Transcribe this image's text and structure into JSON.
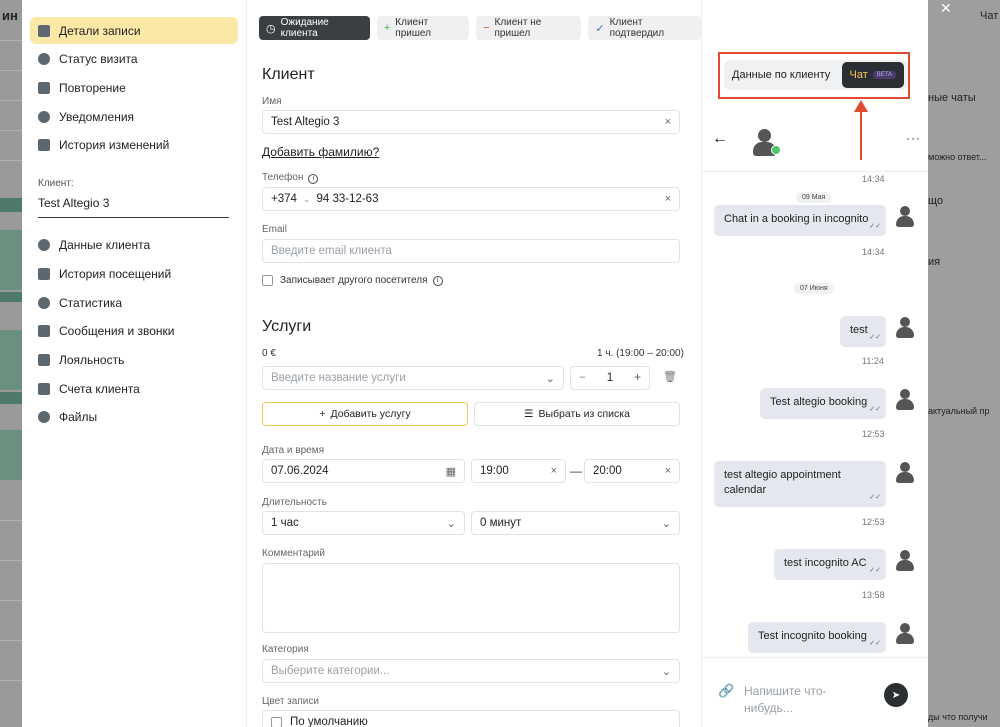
{
  "background": {
    "left_fragment": "ин",
    "right_fragments": [
      "Чат",
      "ные чаты",
      "можно ответ...",
      "що",
      "ия",
      "актуальный пр",
      "ды что получи"
    ],
    "close_symbol": "✕"
  },
  "sidebar": {
    "items": [
      {
        "label": "Детали записи",
        "icon": "calendar-icon"
      },
      {
        "label": "Статус визита",
        "icon": "clock-icon"
      },
      {
        "label": "Повторение",
        "icon": "repeat-icon"
      },
      {
        "label": "Уведомления",
        "icon": "chat-bubbles-icon"
      },
      {
        "label": "История изменений",
        "icon": "document-icon"
      }
    ],
    "client_label": "Клиент:",
    "client_name": "Test Altegio 3",
    "client_items": [
      {
        "label": "Данные клиента",
        "icon": "user-icon"
      },
      {
        "label": "История посещений",
        "icon": "list-icon"
      },
      {
        "label": "Статистика",
        "icon": "pie-chart-icon"
      },
      {
        "label": "Сообщения и звонки",
        "icon": "envelope-icon"
      },
      {
        "label": "Лояльность",
        "icon": "card-icon"
      },
      {
        "label": "Счета клиента",
        "icon": "briefcase-icon"
      },
      {
        "label": "Файлы",
        "icon": "paperclip-icon"
      }
    ]
  },
  "status_buttons": [
    {
      "label": "Ожидание клиента",
      "symbol": "◷"
    },
    {
      "label": "Клиент пришел",
      "symbol": "+"
    },
    {
      "label": "Клиент не пришел",
      "symbol": "−"
    },
    {
      "label": "Клиент подтвердил",
      "symbol": "✓"
    }
  ],
  "client": {
    "title": "Клиент",
    "name_label": "Имя",
    "name_value": "Test Altegio 3",
    "add_surname": "Добавить фамилию?",
    "phone_label": "Телефон",
    "phone_code": "+374",
    "phone_value": "94 33-12-63",
    "email_label": "Email",
    "email_placeholder": "Введите email клиента",
    "other_visitor": "Записывает другого посетителя"
  },
  "services": {
    "title": "Услуги",
    "price": "0 €",
    "duration_summary": "1 ч. (19:00 – 20:00)",
    "service_placeholder": "Введите название услуги",
    "quantity": "1",
    "add_service": "Добавить услугу",
    "choose_from_list": "Выбрать из списка"
  },
  "datetime": {
    "label": "Дата и время",
    "date": "07.06.2024",
    "start": "19:00",
    "end": "20:00",
    "dash": "—"
  },
  "duration": {
    "label": "Длительность",
    "hours": "1 час",
    "minutes": "0 минут"
  },
  "comment": {
    "label": "Комментарий"
  },
  "category": {
    "label": "Категория",
    "placeholder": "Выберите категории..."
  },
  "color": {
    "label": "Цвет записи",
    "value": "По умолчанию"
  },
  "chat": {
    "tab_client_data": "Данные по клиенту",
    "tab_chat": "Чат",
    "beta": "BETA",
    "first_time": "14:34",
    "messages": [
      {
        "type": "date",
        "text": "09 Мая"
      },
      {
        "type": "msg",
        "text": "Chat in a booking in incognito",
        "time": "14:34"
      },
      {
        "type": "date",
        "text": "07 Июня"
      },
      {
        "type": "msg",
        "text": "test",
        "time": "11:24"
      },
      {
        "type": "msg",
        "text": "Test altegio booking",
        "time": "12:53"
      },
      {
        "type": "msg",
        "text": "test altegio appointment calendar",
        "time": "12:53"
      },
      {
        "type": "msg",
        "text": "test incognito AC",
        "time": "13:58"
      },
      {
        "type": "msg",
        "text": "Test incognito booking",
        "time": ""
      }
    ],
    "composer_placeholder": "Напишите что-нибудь..."
  },
  "colors": {
    "accent": "#f2c94c",
    "active_bg": "#fbe8a7",
    "highlight": "#e04a2f"
  }
}
